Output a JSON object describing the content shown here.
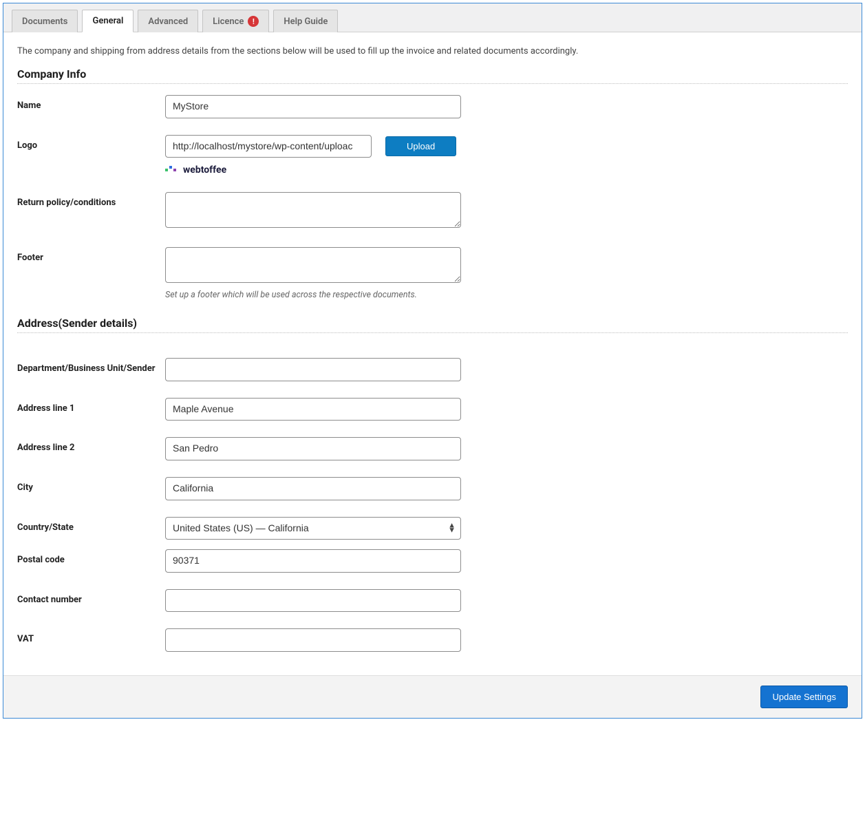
{
  "tabs": {
    "documents": "Documents",
    "general": "General",
    "advanced": "Advanced",
    "licence": "Licence",
    "licence_badge": "!",
    "help": "Help Guide"
  },
  "intro": "The company and shipping from address details from the sections below will be used to fill up the invoice and related documents accordingly.",
  "sections": {
    "company": "Company Info",
    "address": "Address(Sender details)"
  },
  "labels": {
    "name": "Name",
    "logo": "Logo",
    "return_policy": "Return policy/conditions",
    "footer": "Footer",
    "department": "Department/Business Unit/Sender",
    "address1": "Address line 1",
    "address2": "Address line 2",
    "city": "City",
    "country": "Country/State",
    "postal": "Postal code",
    "contact": "Contact number",
    "vat": "VAT"
  },
  "values": {
    "name": "MyStore",
    "logo_url": "http://localhost/mystore/wp-content/uploac",
    "return_policy": "",
    "footer": "",
    "department": "",
    "address1": "Maple Avenue",
    "address2": "San Pedro",
    "city": "California",
    "country": "United States (US) — California",
    "postal": "90371",
    "contact": "",
    "vat": ""
  },
  "buttons": {
    "upload": "Upload",
    "update": "Update Settings"
  },
  "help": {
    "footer": "Set up a footer which will be used across the respective documents."
  },
  "logo_preview_text": "webtoffee"
}
